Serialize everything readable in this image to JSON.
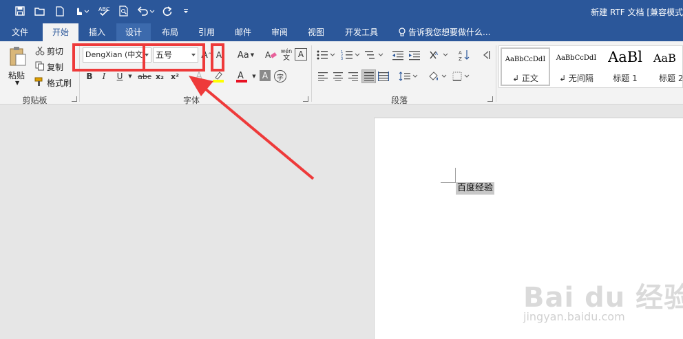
{
  "window": {
    "title": "新建 RTF 文档 [兼容模式"
  },
  "tabs": [
    {
      "label": "文件"
    },
    {
      "label": "开始"
    },
    {
      "label": "插入"
    },
    {
      "label": "设计"
    },
    {
      "label": "布局"
    },
    {
      "label": "引用"
    },
    {
      "label": "邮件"
    },
    {
      "label": "审阅"
    },
    {
      "label": "视图"
    },
    {
      "label": "开发工具"
    }
  ],
  "tell_me": "告诉我您想要做什么...",
  "clipboard": {
    "paste": "粘贴",
    "cut": "剪切",
    "copy": "复制",
    "format_painter": "格式刷",
    "group_label": "剪贴板"
  },
  "font": {
    "font_name": "DengXian (中文",
    "font_size": "五号",
    "change_case": "Aa",
    "group_label": "字体",
    "bold": "B",
    "italic": "I",
    "underline": "U",
    "strike": "abc",
    "subscript": "x₂",
    "superscript": "x²",
    "phonetic": "wén",
    "enclose": "字"
  },
  "paragraph": {
    "group_label": "段落"
  },
  "styles": [
    {
      "preview": "AaBbCcDdI",
      "name": "↲ 正文"
    },
    {
      "preview": "AaBbCcDdI",
      "name": "↲ 无间隔"
    },
    {
      "preview": "AaBl",
      "name": "标题 1"
    },
    {
      "preview": "AaB",
      "name": "标题 2"
    }
  ],
  "document": {
    "text": "百度经验"
  },
  "watermark": {
    "logo": "Bai du 经验",
    "url": "jingyan.baidu.com"
  },
  "colors": {
    "accent": "#2b579a",
    "annotation": "#ee3a3a",
    "highlight": "#ffff00",
    "font_color": "#e81123"
  }
}
